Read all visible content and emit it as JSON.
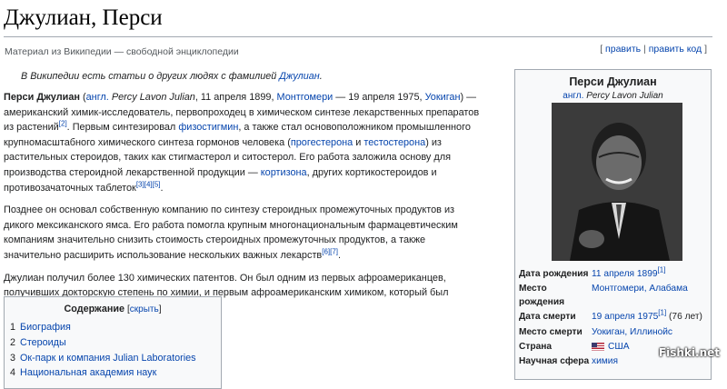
{
  "page": {
    "title": "Джулиан, Перси",
    "tagline": "Материал из Википедии — свободной энциклопедии",
    "edit_links": {
      "edit": "править",
      "edit_code": "править код"
    }
  },
  "hatnote": {
    "prefix": "В Википедии есть статьи о других людях с фамилией ",
    "link": "Джулиан",
    "suffix": "."
  },
  "paragraphs": {
    "p1": {
      "name": "Перси Джулиан",
      "open": " (",
      "lang": "англ.",
      "orig": " Percy Lavon Julian",
      "t1": ", 11 апреля 1899, ",
      "place_birth": "Монтгомери",
      "t2": " — 19 апреля 1975, ",
      "place_death": "Уокиган",
      "t3": ") — американский химик-исследователь, первопроходец в химическом синтезе лекарственных препаратов из растений",
      "ref2": "[2]",
      "t4": ". Первым синтезировал ",
      "link_physo": "физостигмин",
      "t5": ", а также стал основоположником промышленного крупномасштабного химического синтеза гормонов человека (",
      "link_prog": "прогестерона",
      "t6": " и ",
      "link_test": "тестостерона",
      "t7": ") из растительных стероидов, таких как стигмастерол и ситостерол. Его работа заложила основу для производства стероидной лекарственной продукции — ",
      "link_cort": "кортизона",
      "t8": ", других кортикостероидов и противозачаточных таблеток",
      "ref345": "[3][4][5]",
      "t9": "."
    },
    "p2": {
      "text": "Позднее он основал собственную компанию по синтезу стероидных промежуточных продуктов из дикого мексиканского ямса. Его работа помогла крупным многонациональным фармацевтическим компаниям значительно снизить стоимость стероидных промежуточных продуктов, а также значительно расширить использование нескольких важных лекарств",
      "ref67": "[6][7]",
      "end": "."
    },
    "p3": {
      "text": "Джулиан получил более 130 химических патентов. Он был одним из первых афроамериканцев, получивших докторскую степень по химии, и первым афроамериканским химиком, который был введен в Национальную академию наук."
    }
  },
  "toc": {
    "title": "Содержание",
    "hide": "скрыть",
    "items": [
      {
        "num": "1",
        "label": "Биография"
      },
      {
        "num": "2",
        "label": "Стероиды"
      },
      {
        "num": "3",
        "label": "Ок-парк и компания Julian Laboratories"
      },
      {
        "num": "4",
        "label": "Национальная академия наук"
      }
    ]
  },
  "infobox": {
    "name": "Перси Джулиан",
    "lang": "англ.",
    "orig": "Percy Lavon Julian",
    "rows": [
      {
        "label": "Дата рождения",
        "value": "11 апреля 1899",
        "ref": "[1]",
        "extra": ""
      },
      {
        "label": "Место рождения",
        "value": "Монтгомери, Алабама",
        "ref": "",
        "extra": ""
      },
      {
        "label": "Дата смерти",
        "value": "19 апреля 1975",
        "ref": "[1]",
        "extra": " (76 лет)"
      },
      {
        "label": "Место смерти",
        "value": "Уокиган, Иллинойс",
        "ref": "",
        "extra": ""
      },
      {
        "label": "Страна",
        "value": "США",
        "ref": "",
        "extra": ""
      },
      {
        "label": "Научная сфера",
        "value": "химия",
        "ref": "",
        "extra": ""
      }
    ]
  },
  "watermark": "Fishki.net",
  "colors": {
    "link": "#0645ad",
    "border": "#a2a9b1",
    "box_bg": "#f8f9fa"
  }
}
